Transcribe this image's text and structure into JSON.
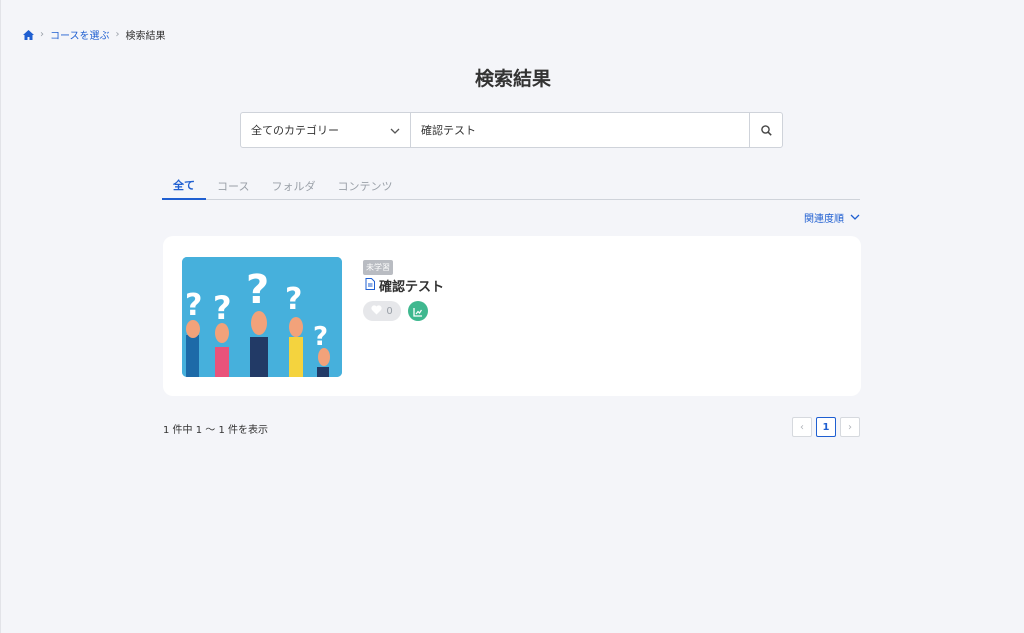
{
  "breadcrumb": {
    "home_icon": "home-icon",
    "items": [
      "コースを選ぶ",
      "検索結果"
    ]
  },
  "page_title": "検索結果",
  "search": {
    "category_value": "全てのカテゴリー",
    "query_value": "確認テスト",
    "search_icon": "search-icon"
  },
  "tabs": [
    "全て",
    "コース",
    "フォルダ",
    "コンテンツ"
  ],
  "active_tab": "全て",
  "sort_label": "関連度順",
  "results": [
    {
      "badge": "未学習",
      "type_icon": "document-icon",
      "title": "確認テスト",
      "likes": "0",
      "thumbnail": "question-marks-hands-illustration"
    }
  ],
  "result_count_text": "1 件中 1 ～ 1 件を表示",
  "pagination": {
    "current_page": "1",
    "prev_label": "‹",
    "next_label": "›"
  },
  "colors": {
    "accent": "#1f5fd1",
    "background": "#f4f5f9",
    "stats_badge": "#3fb88f",
    "thumbnail_bg": "#46b0dc"
  }
}
